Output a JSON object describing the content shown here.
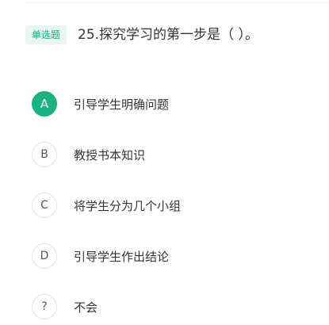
{
  "question": {
    "type_badge": "单选题",
    "text": "25.探究学习的第一步是（ ）。"
  },
  "options": [
    {
      "letter": "A",
      "label": "引导学生明确问题",
      "selected": true
    },
    {
      "letter": "B",
      "label": "教授书本知识",
      "selected": false
    },
    {
      "letter": "C",
      "label": "将学生分为几个小组",
      "selected": false
    },
    {
      "letter": "D",
      "label": "引导学生作出结论",
      "selected": false
    },
    {
      "letter": "?",
      "label": "不会",
      "selected": false
    }
  ],
  "colors": {
    "accent": "#19b382",
    "badge_bg": "#e8f6f1",
    "badge_text": "#17b07b",
    "text": "#333333",
    "circle_border": "#e3e3e3"
  }
}
